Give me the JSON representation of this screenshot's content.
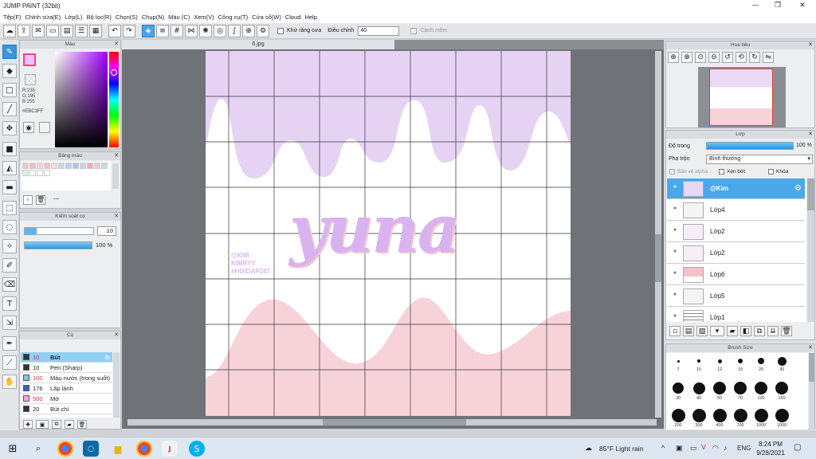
{
  "window": {
    "title": "JUMP PAINT (32bit)",
    "minimize": "—",
    "maximize": "❐",
    "close": "✕"
  },
  "menu": [
    "Tệp(F)",
    "Chỉnh sửa(E)",
    "Lớp(L)",
    "Bộ lọc(R)",
    "Chọn(S)",
    "Chụp(N)",
    "Màu (C)",
    "Xem(V)",
    "Công cụ(T)",
    "Cửa sổ(W)",
    "Cloud",
    "Help"
  ],
  "toolbar": {
    "antialias_label": "Khử răng cưa",
    "adjust_label": "Điều chỉnh",
    "adjust_value": "40",
    "edge_label": "Cạnh mềm"
  },
  "color_panel": {
    "title": "Màu",
    "r": "R:235",
    "g": "G:195",
    "b": "B:255",
    "hex": "#EBC3FF",
    "main_color": "#EBC3FF"
  },
  "palette_panel": {
    "title": "Bảng màu",
    "dash": "---",
    "swatches": [
      "#f6c6cc",
      "#f4b9c1",
      "#f9d2d6",
      "#f5c2c8",
      "#f9d7db",
      "#c7d8ef",
      "#bcd0ea",
      "#a9c6e6",
      "#c3d6ee",
      "#f6a7c0",
      "#f8c7cf",
      "#bfe5c6",
      "#d8f0dd",
      "#ffffff",
      "#ffffff",
      "#ffffff"
    ]
  },
  "brush_control": {
    "title": "Kiểm soát cọ",
    "size": "10",
    "opacity": "100 %"
  },
  "brush_list": {
    "title": "Cọ",
    "items": [
      {
        "size": "10",
        "name": "Bút",
        "color": "#333333",
        "selected": true
      },
      {
        "size": "10",
        "name": "Pen (Sharp)",
        "color": "#333333",
        "selected": false
      },
      {
        "size": "100",
        "name": "Màu nước (trong suốt)",
        "color": "#7ec3e6",
        "selected": false
      },
      {
        "size": "176",
        "name": "Lấp lánh",
        "color": "#3b5bd1",
        "selected": false
      },
      {
        "size": "500",
        "name": "Mờ",
        "color": "#f3a7e0",
        "selected": false
      },
      {
        "size": "20",
        "name": "Bút chì",
        "color": "#333333",
        "selected": false
      }
    ]
  },
  "document": {
    "tab": "6.jpg"
  },
  "canvas": {
    "title": "yuna",
    "credit1": "@KIM",
    "credit2": "KIMRYY",
    "credit3": "#HOIDAP247"
  },
  "navigator": {
    "title": "Hoa tiêu"
  },
  "layer_panel": {
    "title": "Lớp",
    "opacity_label": "Độ trong",
    "opacity_value": "100 %",
    "blend_label": "Pha trộn",
    "blend_value": "Bình thường",
    "protect_label": "Bảo vệ alpha",
    "clip_label": "Xén bớt",
    "lock_label": "Khóa",
    "layers": [
      "@Kim",
      "Lớp4",
      "Lớp2",
      "Lớp2",
      "Lớp6",
      "Lớp5",
      "Lớp1"
    ]
  },
  "brush_size": {
    "title": "Brush Size",
    "sizes": [
      "7",
      "10",
      "12",
      "15",
      "20",
      "30",
      "30",
      "40",
      "50",
      "70",
      "100",
      "150",
      "200",
      "300",
      "400",
      "700",
      "1000",
      "1000"
    ]
  },
  "taskbar": {
    "weather": "85°F  Light rain",
    "lang": "ENG",
    "time": "8:24 PM",
    "date": "9/28/2021"
  }
}
